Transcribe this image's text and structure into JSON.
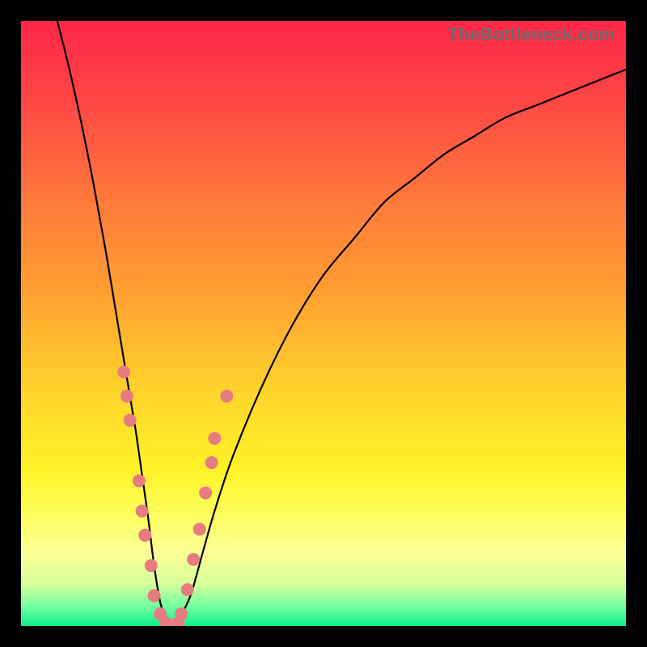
{
  "watermark": "TheBottleneck.com",
  "chart_data": {
    "type": "line",
    "title": "",
    "xlabel": "",
    "ylabel": "",
    "xlim": [
      0,
      100
    ],
    "ylim": [
      0,
      100
    ],
    "gradient_stops": [
      {
        "offset": 0.0,
        "color": "#ff2648"
      },
      {
        "offset": 0.14,
        "color": "#ff4944"
      },
      {
        "offset": 0.3,
        "color": "#ff7a3a"
      },
      {
        "offset": 0.46,
        "color": "#ffa231"
      },
      {
        "offset": 0.62,
        "color": "#ffd62a"
      },
      {
        "offset": 0.74,
        "color": "#fff227"
      },
      {
        "offset": 0.82,
        "color": "#feff60"
      },
      {
        "offset": 0.88,
        "color": "#fbff95"
      },
      {
        "offset": 0.93,
        "color": "#d6ff9a"
      },
      {
        "offset": 0.965,
        "color": "#7affa0"
      },
      {
        "offset": 1.0,
        "color": "#0cf08a"
      }
    ],
    "series": [
      {
        "name": "bottleneck-curve",
        "x": [
          6,
          8,
          10,
          12,
          14,
          16,
          18,
          19,
          20,
          21,
          22,
          23,
          24,
          25,
          26,
          28,
          30,
          32,
          35,
          40,
          45,
          50,
          55,
          60,
          65,
          70,
          75,
          80,
          85,
          90,
          95,
          100
        ],
        "y": [
          100,
          92,
          83,
          73,
          62,
          50,
          38,
          32,
          25,
          18,
          10,
          4,
          1,
          0,
          1,
          5,
          12,
          19,
          28,
          40,
          50,
          58,
          64,
          70,
          74,
          78,
          81,
          84,
          86,
          88,
          90,
          92
        ]
      }
    ],
    "scatter": {
      "name": "data-dots",
      "points": [
        {
          "x": 17.0,
          "y": 42
        },
        {
          "x": 17.5,
          "y": 38
        },
        {
          "x": 18.0,
          "y": 34
        },
        {
          "x": 19.5,
          "y": 24
        },
        {
          "x": 20.0,
          "y": 19
        },
        {
          "x": 20.5,
          "y": 15
        },
        {
          "x": 21.5,
          "y": 10
        },
        {
          "x": 22.0,
          "y": 5
        },
        {
          "x": 23.0,
          "y": 2
        },
        {
          "x": 24.0,
          "y": 0.5
        },
        {
          "x": 25.0,
          "y": 0
        },
        {
          "x": 26.0,
          "y": 0.5
        },
        {
          "x": 26.5,
          "y": 2
        },
        {
          "x": 27.5,
          "y": 6
        },
        {
          "x": 28.5,
          "y": 11
        },
        {
          "x": 29.5,
          "y": 16
        },
        {
          "x": 30.5,
          "y": 22
        },
        {
          "x": 31.5,
          "y": 27
        },
        {
          "x": 32.0,
          "y": 31
        },
        {
          "x": 34.0,
          "y": 38
        }
      ]
    }
  }
}
